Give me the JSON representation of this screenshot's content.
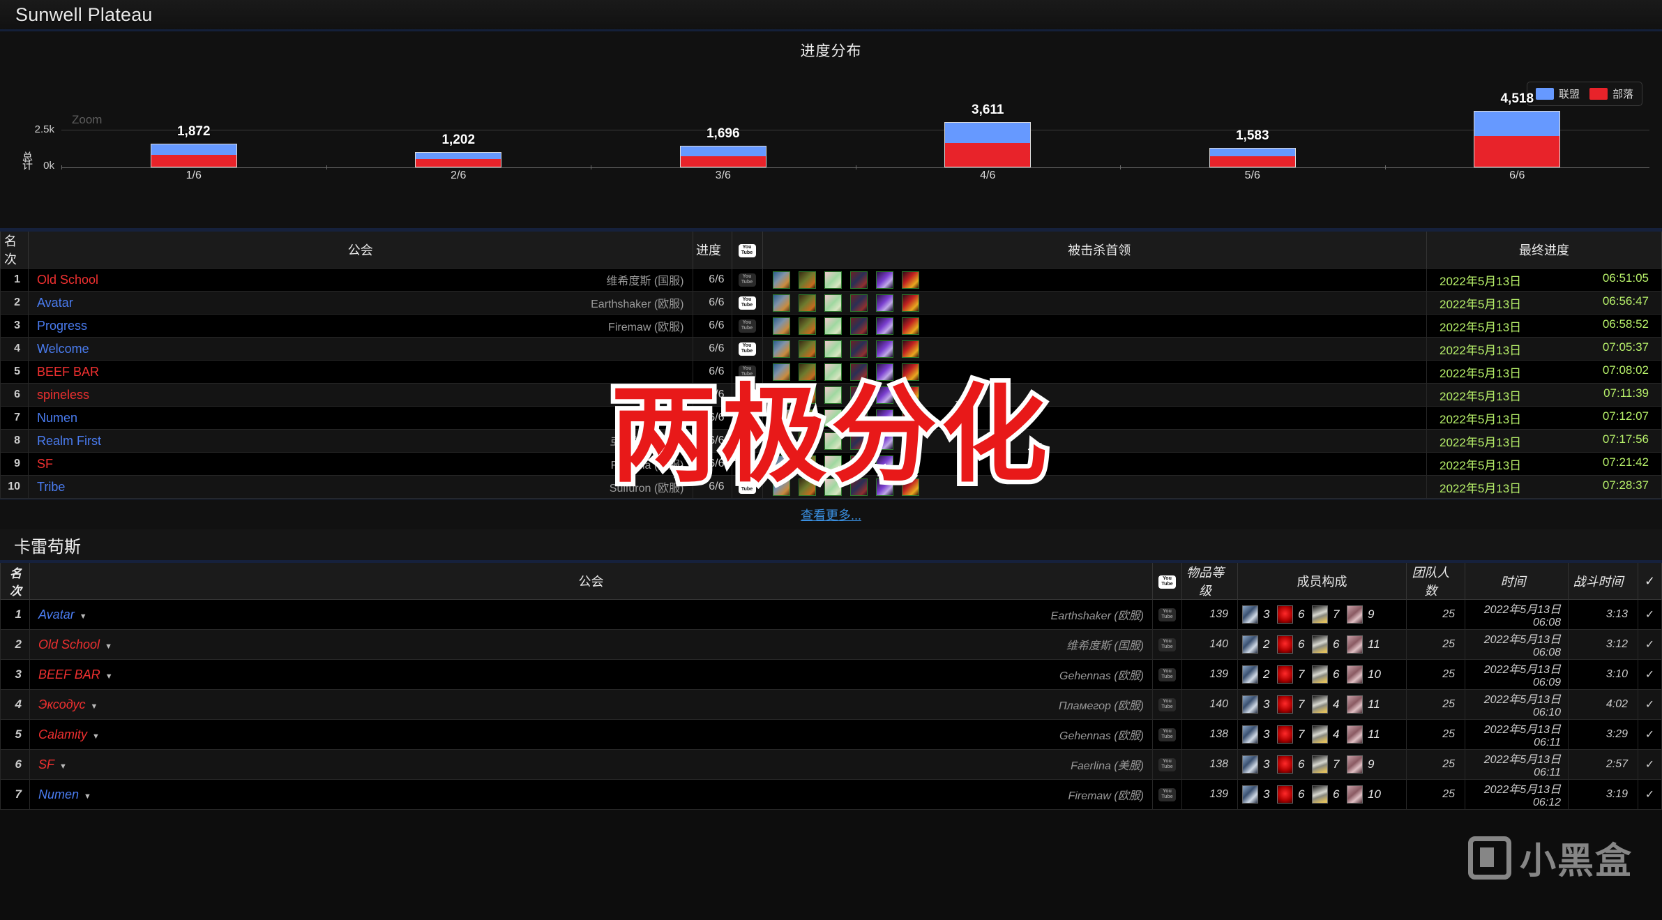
{
  "header": {
    "title": "Sunwell Plateau"
  },
  "chart_data": {
    "type": "bar",
    "title": "进度分布",
    "ylabel": "总计",
    "xlabel": "",
    "zoom_label": "Zoom",
    "categories": [
      "1/6",
      "2/6",
      "3/6",
      "4/6",
      "5/6",
      "6/6"
    ],
    "totals": [
      1872,
      1202,
      1696,
      3611,
      1583,
      4518
    ],
    "total_labels": [
      "1,872",
      "1,202",
      "1,696",
      "3,611",
      "1,583",
      "4,518"
    ],
    "series": [
      {
        "name": "联盟",
        "color": "#6699ff",
        "values": [
          860,
          560,
          790,
          1640,
          690,
          2040
        ]
      },
      {
        "name": "部落",
        "color": "#e8232a",
        "values": [
          1012,
          642,
          906,
          1971,
          893,
          2478
        ]
      }
    ],
    "ylim": [
      0,
      5000
    ],
    "ytick_labels": [
      "2.5k",
      "0k"
    ],
    "grid": true,
    "legend_position": "top-right",
    "stacked": true
  },
  "table1": {
    "headers": {
      "rank": "名次",
      "guild": "公会",
      "progress": "进度",
      "video": "youtube-icon",
      "bosses": "被击杀首领",
      "final": "最终进度"
    },
    "rows": [
      {
        "rank": "1",
        "guild": "Old School",
        "faction": "horde",
        "realm": "维希度斯 (国服)",
        "progress": "6/6",
        "video": true,
        "bosses": [
          1,
          1,
          1,
          1,
          1,
          1
        ],
        "date": "2022年5月13日",
        "time": "06:51:05"
      },
      {
        "rank": "2",
        "guild": "Avatar",
        "faction": "alliance",
        "realm": "Earthshaker (欧服)",
        "progress": "6/6",
        "video": true,
        "bosses": [
          1,
          1,
          1,
          1,
          1,
          1
        ],
        "date": "2022年5月13日",
        "time": "06:56:47"
      },
      {
        "rank": "3",
        "guild": "Progress",
        "faction": "alliance",
        "realm": "Firemaw (欧服)",
        "progress": "6/6",
        "video": true,
        "bosses": [
          1,
          1,
          1,
          1,
          1,
          1
        ],
        "date": "2022年5月13日",
        "time": "06:58:52"
      },
      {
        "rank": "4",
        "guild": "Welcome",
        "faction": "alliance",
        "realm": "",
        "progress": "6/6",
        "video": true,
        "bosses": [
          1,
          1,
          1,
          1,
          1,
          1
        ],
        "date": "2022年5月13日",
        "time": "07:05:37"
      },
      {
        "rank": "5",
        "guild": "BEEF BAR",
        "faction": "horde",
        "realm": "",
        "progress": "6/6",
        "video": true,
        "bosses": [
          1,
          1,
          1,
          1,
          1,
          1
        ],
        "date": "2022年5月13日",
        "time": "07:08:02"
      },
      {
        "rank": "6",
        "guild": "spineless",
        "faction": "horde",
        "realm": "",
        "progress": "6/6",
        "video": true,
        "bosses": [
          1,
          1,
          1,
          1,
          1,
          1
        ],
        "date": "2022年5月13日",
        "time": "07:11:39"
      },
      {
        "rank": "7",
        "guild": "Numen",
        "faction": "alliance",
        "realm": "",
        "progress": "6/6",
        "video": true,
        "bosses": [
          1,
          1,
          1,
          1,
          1,
          1
        ],
        "date": "2022年5月13日",
        "time": "07:12:07"
      },
      {
        "rank": "8",
        "guild": "Realm First",
        "faction": "alliance",
        "realm": "로크홀라 (韩服)",
        "progress": "6/6",
        "video": true,
        "bosses": [
          1,
          1,
          1,
          1,
          1,
          1
        ],
        "date": "2022年5月13日",
        "time": "07:17:56"
      },
      {
        "rank": "9",
        "guild": "SF",
        "faction": "horde",
        "realm": "Faerlina (美服)",
        "progress": "6/6",
        "video": true,
        "bosses": [
          1,
          1,
          1,
          1,
          1,
          1
        ],
        "date": "2022年5月13日",
        "time": "07:21:42"
      },
      {
        "rank": "10",
        "guild": "Tribe",
        "faction": "alliance",
        "realm": "Sulfuron (欧服)",
        "progress": "6/6",
        "video": true,
        "bosses": [
          1,
          1,
          1,
          1,
          1,
          1
        ],
        "date": "2022年5月13日",
        "time": "07:28:37"
      }
    ],
    "view_more": "查看更多..."
  },
  "section2": {
    "title": "卡雷苟斯"
  },
  "table2": {
    "headers": {
      "rank": "名次",
      "guild": "公会",
      "video": "youtube-icon",
      "ilvl": "物品等级",
      "comp": "成员构成",
      "size": "团队人数",
      "time": "时间",
      "duration": "战斗时间",
      "check": "✓"
    },
    "rows": [
      {
        "rank": "1",
        "guild": "Avatar",
        "faction": "alliance",
        "realm": "Earthshaker (欧服)",
        "ilvl": "139",
        "tank": "3",
        "heal": "6",
        "melee": "7",
        "ranged": "9",
        "size": "25",
        "time": "2022年5月13日 06:08",
        "duration": "3:13",
        "check": "✓"
      },
      {
        "rank": "2",
        "guild": "Old School",
        "faction": "horde",
        "realm": "维希度斯 (国服)",
        "ilvl": "140",
        "tank": "2",
        "heal": "6",
        "melee": "6",
        "ranged": "11",
        "size": "25",
        "time": "2022年5月13日 06:08",
        "duration": "3:12",
        "check": "✓"
      },
      {
        "rank": "3",
        "guild": "BEEF BAR",
        "faction": "horde",
        "realm": "Gehennas (欧服)",
        "ilvl": "139",
        "tank": "2",
        "heal": "7",
        "melee": "6",
        "ranged": "10",
        "size": "25",
        "time": "2022年5月13日 06:09",
        "duration": "3:10",
        "check": "✓"
      },
      {
        "rank": "4",
        "guild": "Эксодус",
        "faction": "horde",
        "realm": "Пламегор (欧服)",
        "ilvl": "140",
        "tank": "3",
        "heal": "7",
        "melee": "4",
        "ranged": "11",
        "size": "25",
        "time": "2022年5月13日 06:10",
        "duration": "4:02",
        "check": "✓"
      },
      {
        "rank": "5",
        "guild": "Calamity",
        "faction": "horde",
        "realm": "Gehennas (欧服)",
        "ilvl": "138",
        "tank": "3",
        "heal": "7",
        "melee": "4",
        "ranged": "11",
        "size": "25",
        "time": "2022年5月13日 06:11",
        "duration": "3:29",
        "check": "✓"
      },
      {
        "rank": "6",
        "guild": "SF",
        "faction": "horde",
        "realm": "Faerlina (美服)",
        "ilvl": "138",
        "tank": "3",
        "heal": "6",
        "melee": "7",
        "ranged": "9",
        "size": "25",
        "time": "2022年5月13日 06:11",
        "duration": "2:57",
        "check": "✓"
      },
      {
        "rank": "7",
        "guild": "Numen",
        "faction": "alliance",
        "realm": "Firemaw (欧服)",
        "ilvl": "139",
        "tank": "3",
        "heal": "6",
        "melee": "6",
        "ranged": "10",
        "size": "25",
        "time": "2022年5月13日 06:12",
        "duration": "3:19",
        "check": "✓"
      }
    ]
  },
  "overlay": {
    "big_text": "两极分化",
    "watermark": "小黑盒"
  }
}
